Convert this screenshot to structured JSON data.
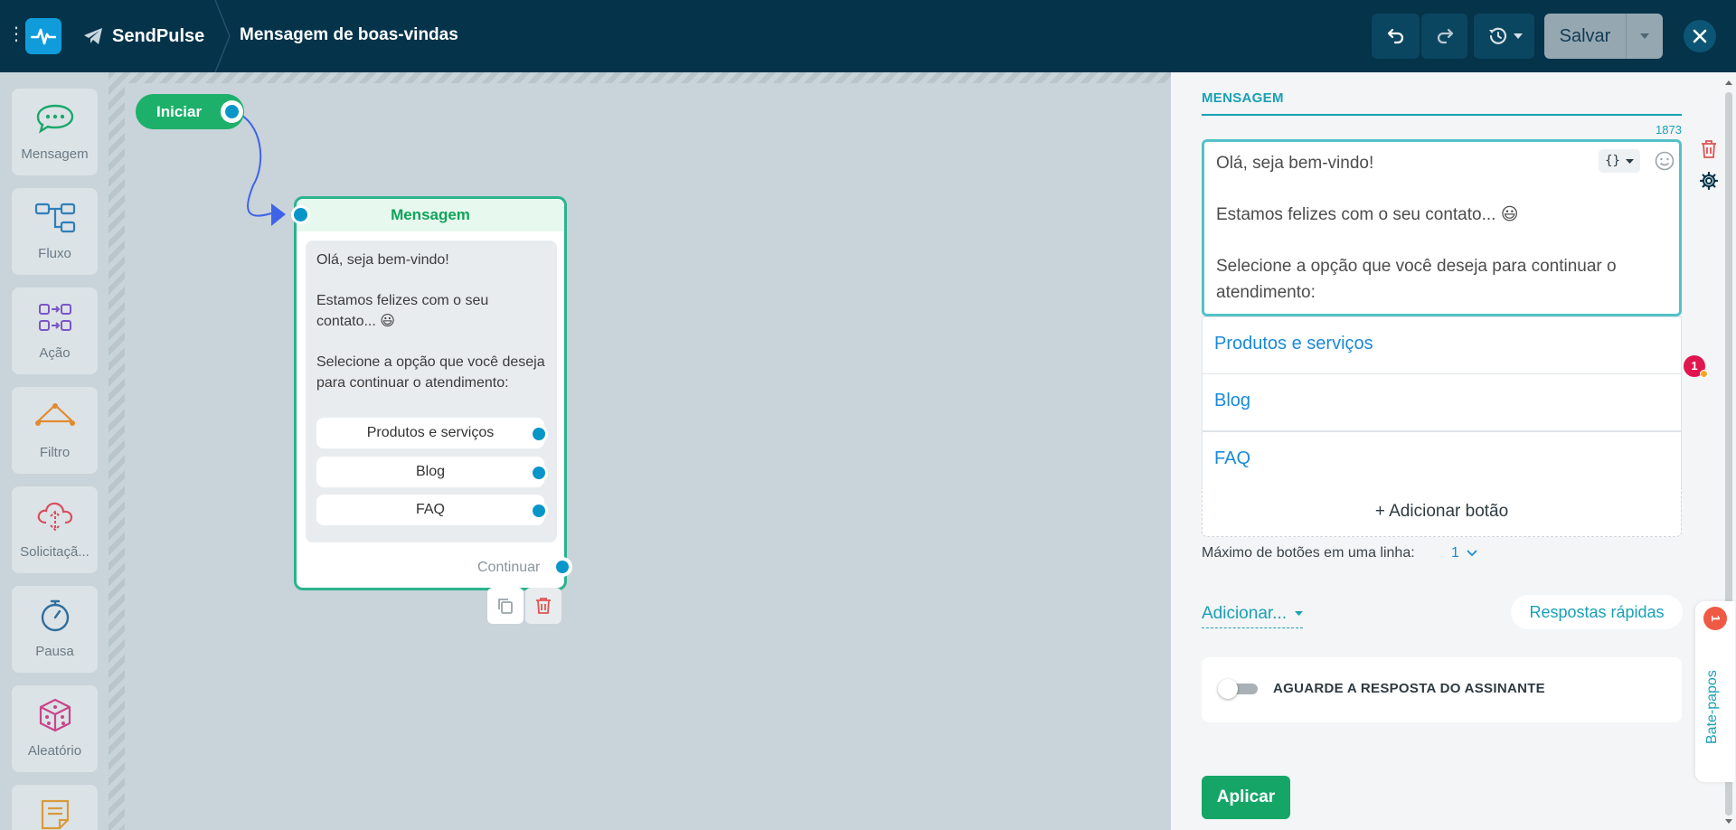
{
  "app": {
    "brand": "SendPulse",
    "page_title": "Mensagem de boas-vindas",
    "save_label": "Salvar",
    "colors": {
      "topbar": "#04334a",
      "accent": "#1aa0b5",
      "success": "#15a667",
      "port": "#0896c9",
      "danger": "#e0174f"
    }
  },
  "sidebar": {
    "items": [
      {
        "label": "Mensagem",
        "icon": "chat-bubble-icon"
      },
      {
        "label": "Fluxo",
        "icon": "flow-icon"
      },
      {
        "label": "Ação",
        "icon": "action-icon"
      },
      {
        "label": "Filtro",
        "icon": "filter-icon"
      },
      {
        "label": "Solicitaçã...",
        "icon": "cloud-request-icon"
      },
      {
        "label": "Pausa",
        "icon": "stopwatch-icon"
      },
      {
        "label": "Aleatório",
        "icon": "dice-icon"
      }
    ]
  },
  "canvas": {
    "start_label": "Iniciar",
    "node": {
      "title": "Mensagem",
      "lines": [
        "Olá, seja bem-vindo!",
        "Estamos felizes com o seu contato... 😃",
        "Selecione a opção que você deseja para continuar o atendimento:"
      ],
      "buttons": [
        "Produtos e serviços",
        "Blog",
        "FAQ"
      ],
      "continue_label": "Continuar"
    }
  },
  "panel": {
    "section_title": "MENSAGEM",
    "char_counter": "1873",
    "message_lines": [
      "Olá, seja bem-vindo!",
      "Estamos felizes com o seu contato... 😃",
      "Selecione a opção que você deseja para continuar o atendimento:"
    ],
    "error_count": "1",
    "buttons": [
      "Produtos e serviços",
      "Blog",
      "FAQ"
    ],
    "add_button_label": "+ Adicionar botão",
    "max_per_line_label": "Máximo de botões em uma linha:",
    "max_per_line_value": "1",
    "add_menu_label": "Adicionar...",
    "quick_replies_label": "Respostas rápidas",
    "wait_toggle_label": "AGUARDE A RESPOSTA DO ASSINANTE",
    "wait_toggle_on": false,
    "apply_label": "Aplicar",
    "chats_tab_label": "Bate-papos",
    "chats_badge": "1"
  }
}
